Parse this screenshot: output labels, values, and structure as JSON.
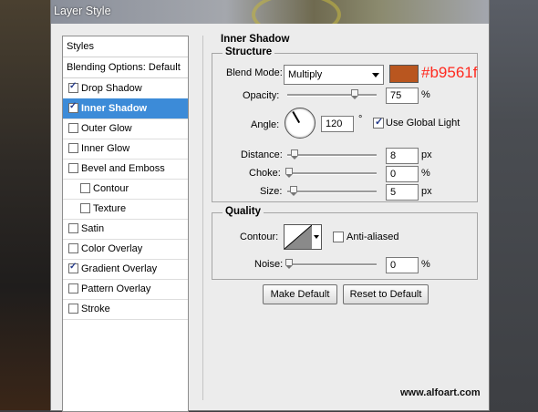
{
  "window": {
    "title": "Layer Style"
  },
  "styles_list": {
    "header": "Styles",
    "blending": "Blending Options: Default",
    "items": [
      {
        "label": "Drop Shadow",
        "checked": true
      },
      {
        "label": "Inner Shadow",
        "checked": true,
        "active": true
      },
      {
        "label": "Outer Glow",
        "checked": false
      },
      {
        "label": "Inner Glow",
        "checked": false
      },
      {
        "label": "Bevel and Emboss",
        "checked": false
      },
      {
        "label": "Contour",
        "checked": false,
        "sub": true
      },
      {
        "label": "Texture",
        "checked": false,
        "sub": true
      },
      {
        "label": "Satin",
        "checked": false
      },
      {
        "label": "Color Overlay",
        "checked": false
      },
      {
        "label": "Gradient Overlay",
        "checked": true
      },
      {
        "label": "Pattern Overlay",
        "checked": false
      },
      {
        "label": "Stroke",
        "checked": false
      }
    ]
  },
  "panel": {
    "title": "Inner Shadow",
    "structure": {
      "legend": "Structure",
      "blend_mode_label": "Blend Mode:",
      "blend_mode_value": "Multiply",
      "color_hex": "#b9561f",
      "color_note": "#b9561f",
      "opacity_label": "Opacity:",
      "opacity_value": "75",
      "opacity_unit": "%",
      "opacity_level": 0.75,
      "angle_label": "Angle:",
      "angle_value": "120",
      "angle_unit": "°",
      "use_global_light_label": "Use Global Light",
      "use_global_light_checked": true,
      "distance_label": "Distance:",
      "distance_value": "8",
      "distance_unit": "px",
      "distance_level": 0.03,
      "choke_label": "Choke:",
      "choke_value": "0",
      "choke_unit": "%",
      "choke_level": 0.0,
      "size_label": "Size:",
      "size_value": "5",
      "size_unit": "px",
      "size_level": 0.02
    },
    "quality": {
      "legend": "Quality",
      "contour_label": "Contour:",
      "anti_aliased_label": "Anti-aliased",
      "anti_aliased_checked": false,
      "noise_label": "Noise:",
      "noise_value": "0",
      "noise_unit": "%",
      "noise_level": 0.0
    },
    "buttons": {
      "make_default": "Make Default",
      "reset_default": "Reset to Default"
    }
  },
  "watermark": "www.alfoart.com",
  "icons": {
    "dropdown": "chevron-down-icon",
    "angle": "angle-dial-icon",
    "contour": "contour-preview-icon"
  }
}
